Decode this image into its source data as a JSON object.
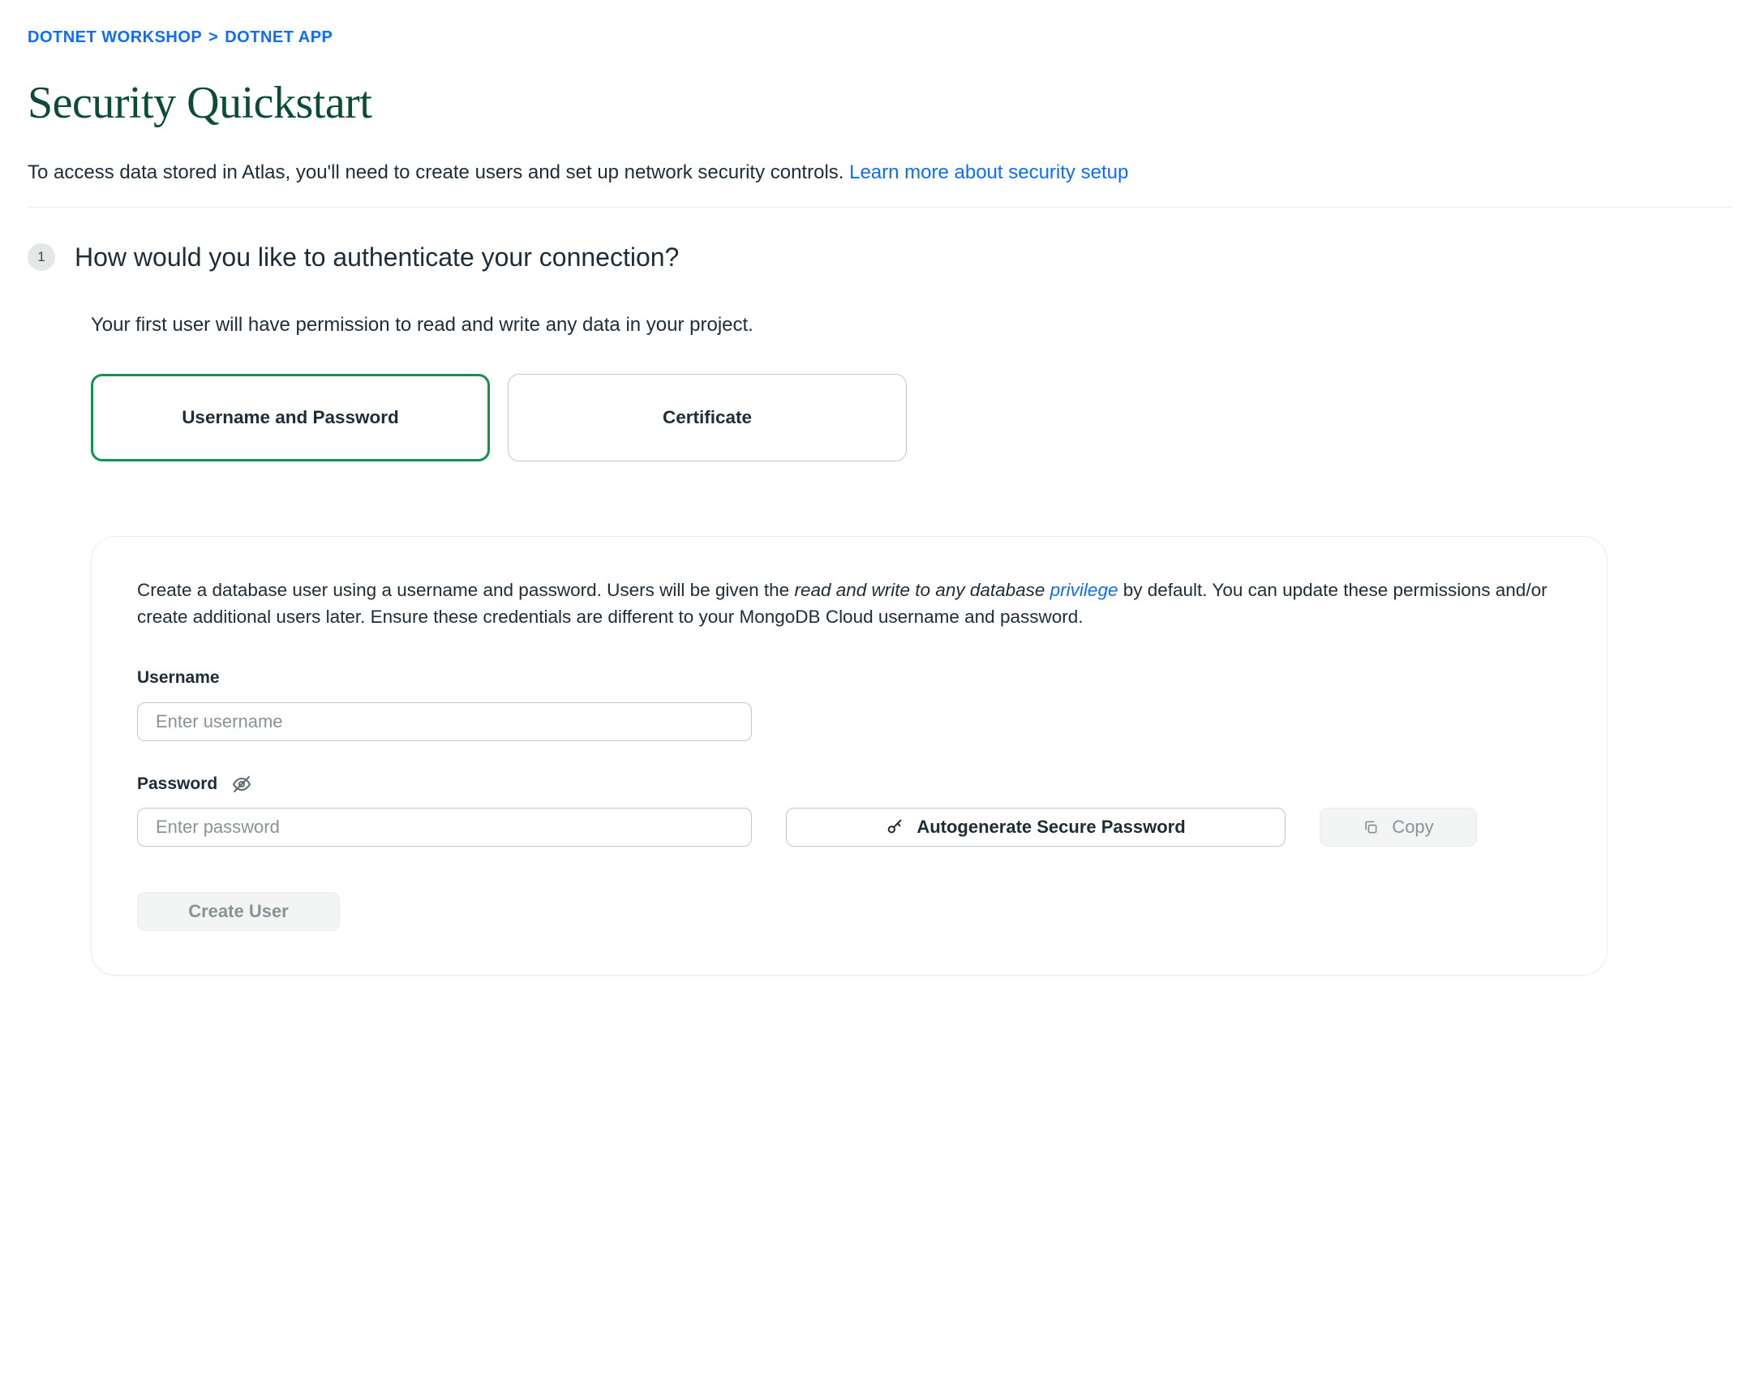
{
  "breadcrumb": {
    "items": [
      "DOTNET WORKSHOP",
      "DOTNET APP"
    ],
    "separator": ">"
  },
  "title": "Security Quickstart",
  "lead": {
    "text": "To access data stored in Atlas, you'll need to create users and set up network security controls. ",
    "link_text": "Learn more about security setup"
  },
  "step1": {
    "number": "1",
    "heading": "How would you like to authenticate your connection?",
    "subheading": "Your first user will have permission to read and write any data in your project.",
    "auth_options": [
      {
        "label": "Username and Password",
        "selected": true
      },
      {
        "label": "Certificate",
        "selected": false
      }
    ],
    "card": {
      "desc_prefix": "Create a database user using a username and password. Users will be given the ",
      "desc_emphasis": "read and write to any database ",
      "desc_link": "privilege",
      "desc_suffix": " by default. You can update these permissions and/or create additional users later. Ensure these credentials are different to your MongoDB Cloud username and password.",
      "username_label": "Username",
      "username_placeholder": "Enter username",
      "password_label": "Password",
      "password_placeholder": "Enter password",
      "autogen_label": "Autogenerate Secure Password",
      "copy_label": "Copy",
      "create_label": "Create User"
    }
  }
}
